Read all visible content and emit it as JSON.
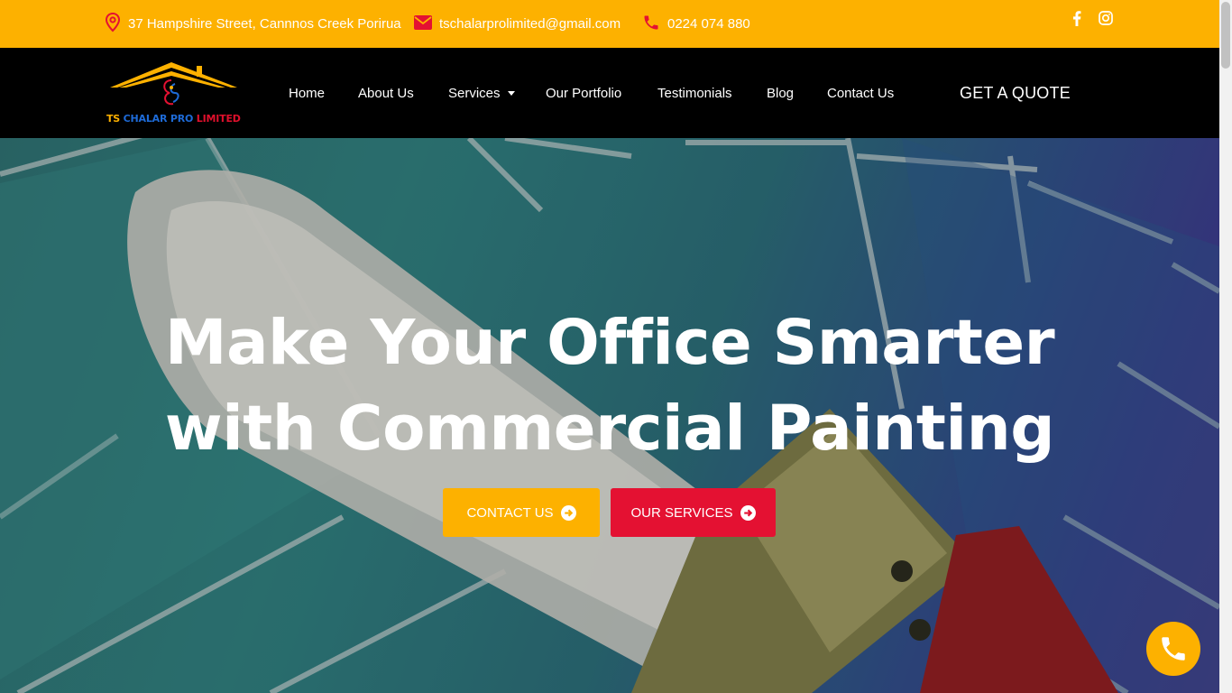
{
  "topbar": {
    "address": "37 Hampshire Street, Cannnos Creek Porirua",
    "email": "tschalarprolimited@gmail.com",
    "phone": "0224 074 880",
    "icons": [
      "map-pin-icon",
      "mail-icon",
      "phone-icon",
      "facebook-icon",
      "instagram-icon"
    ]
  },
  "brand": {
    "logo_text_ts": "TS",
    "logo_text_rest": " CHALAR PRO ",
    "logo_text_ltd": "LIMITED"
  },
  "nav": {
    "items": [
      {
        "label": "Home"
      },
      {
        "label": "About Us"
      },
      {
        "label": "Services"
      },
      {
        "label": "Our Portfolio"
      },
      {
        "label": "Testimonials"
      },
      {
        "label": "Blog"
      },
      {
        "label": "Contact Us"
      }
    ],
    "cta": "GET A QUOTE"
  },
  "hero": {
    "headline_line1": "Make Your Office Smarter",
    "headline_line2": "with Commercial Painting",
    "buttons": [
      {
        "label": "CONTACT US"
      },
      {
        "label": "OUR SERVICES"
      }
    ]
  },
  "colors": {
    "accent": "#fdb100",
    "brand_red": "#e41132",
    "nav_bg": "#000000"
  }
}
